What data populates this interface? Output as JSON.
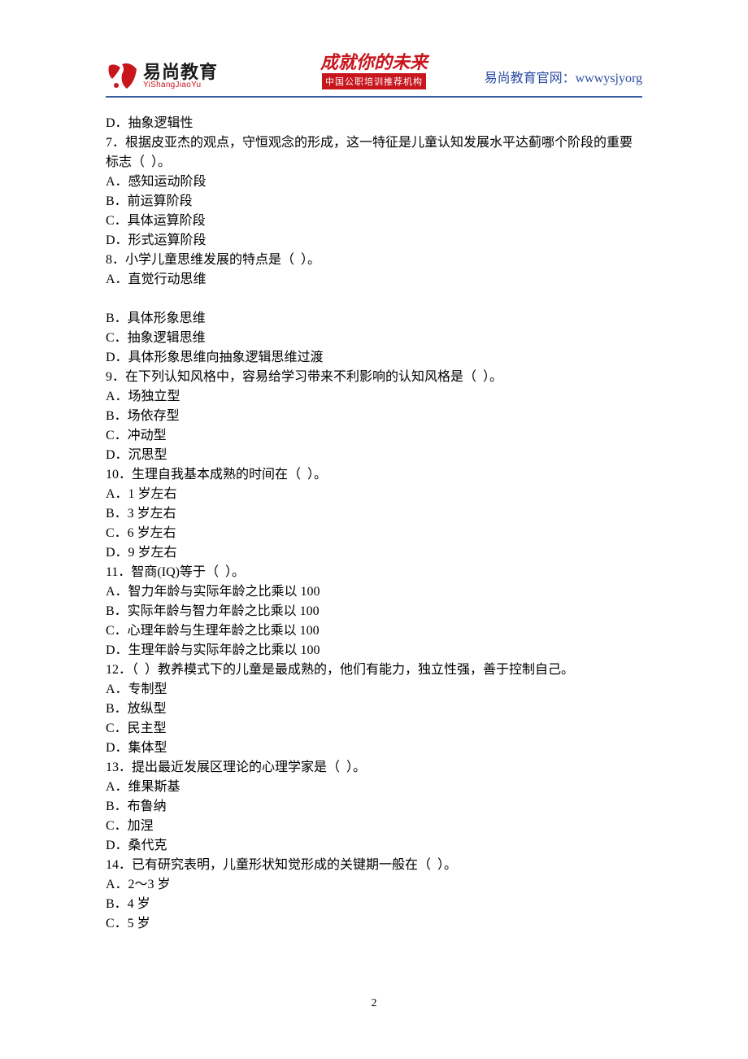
{
  "header": {
    "logo_cn": "易尚教育",
    "logo_py": "YiShangJiaoYu",
    "slogan": "成就你的未来",
    "badge": "中国公职培训推荐机构",
    "site_label": "易尚教育官网：wwwysjyorg"
  },
  "lines": [
    "D．抽象逻辑性",
    "7．根据皮亚杰的观点，守恒观念的形成，这一特征是儿童认知发展水平达蓟哪个阶段的重要标志（  ）。",
    "A．感知运动阶段",
    "B．前运算阶段",
    "C．具体运算阶段",
    "D．形式运算阶段",
    "8．小学儿童思维发展的特点是（  ）。",
    "A．直觉行动思维",
    "",
    "B．具体形象思维",
    "C．抽象逻辑思维",
    "D．具体形象思维向抽象逻辑思维过渡",
    "9．在下列认知风格中，容易给学习带来不利影响的认知风格是（  ）。",
    "A．场独立型",
    "B．场依存型",
    "C．冲动型",
    "D．沉思型",
    "10．生理自我基本成熟的时间在（  ）。",
    "A．1 岁左右",
    "B．3 岁左右",
    "C．6 岁左右",
    "D．9 岁左右",
    "11．智商(IQ)等于（  ）。",
    "A．智力年龄与实际年龄之比乘以 100",
    "B．实际年龄与智力年龄之比乘以 100",
    "C．心理年龄与生理年龄之比乘以 100",
    "D．生理年龄与实际年龄之比乘以 100",
    "12．（  ）教养模式下的儿童是最成熟的，他们有能力，独立性强，善于控制自己。",
    "A．专制型",
    "B．放纵型",
    "C．民主型",
    "D．集体型",
    "13．提出最近发展区理论的心理学家是（  ）。",
    "A．维果斯基",
    "B．布鲁纳",
    "C．加涅",
    "D．桑代克",
    "14．已有研究表明，儿童形状知觉形成的关键期一般在（  ）。",
    "A．2～3 岁",
    "B．4 岁",
    "C．5 岁"
  ],
  "page_number": "2"
}
